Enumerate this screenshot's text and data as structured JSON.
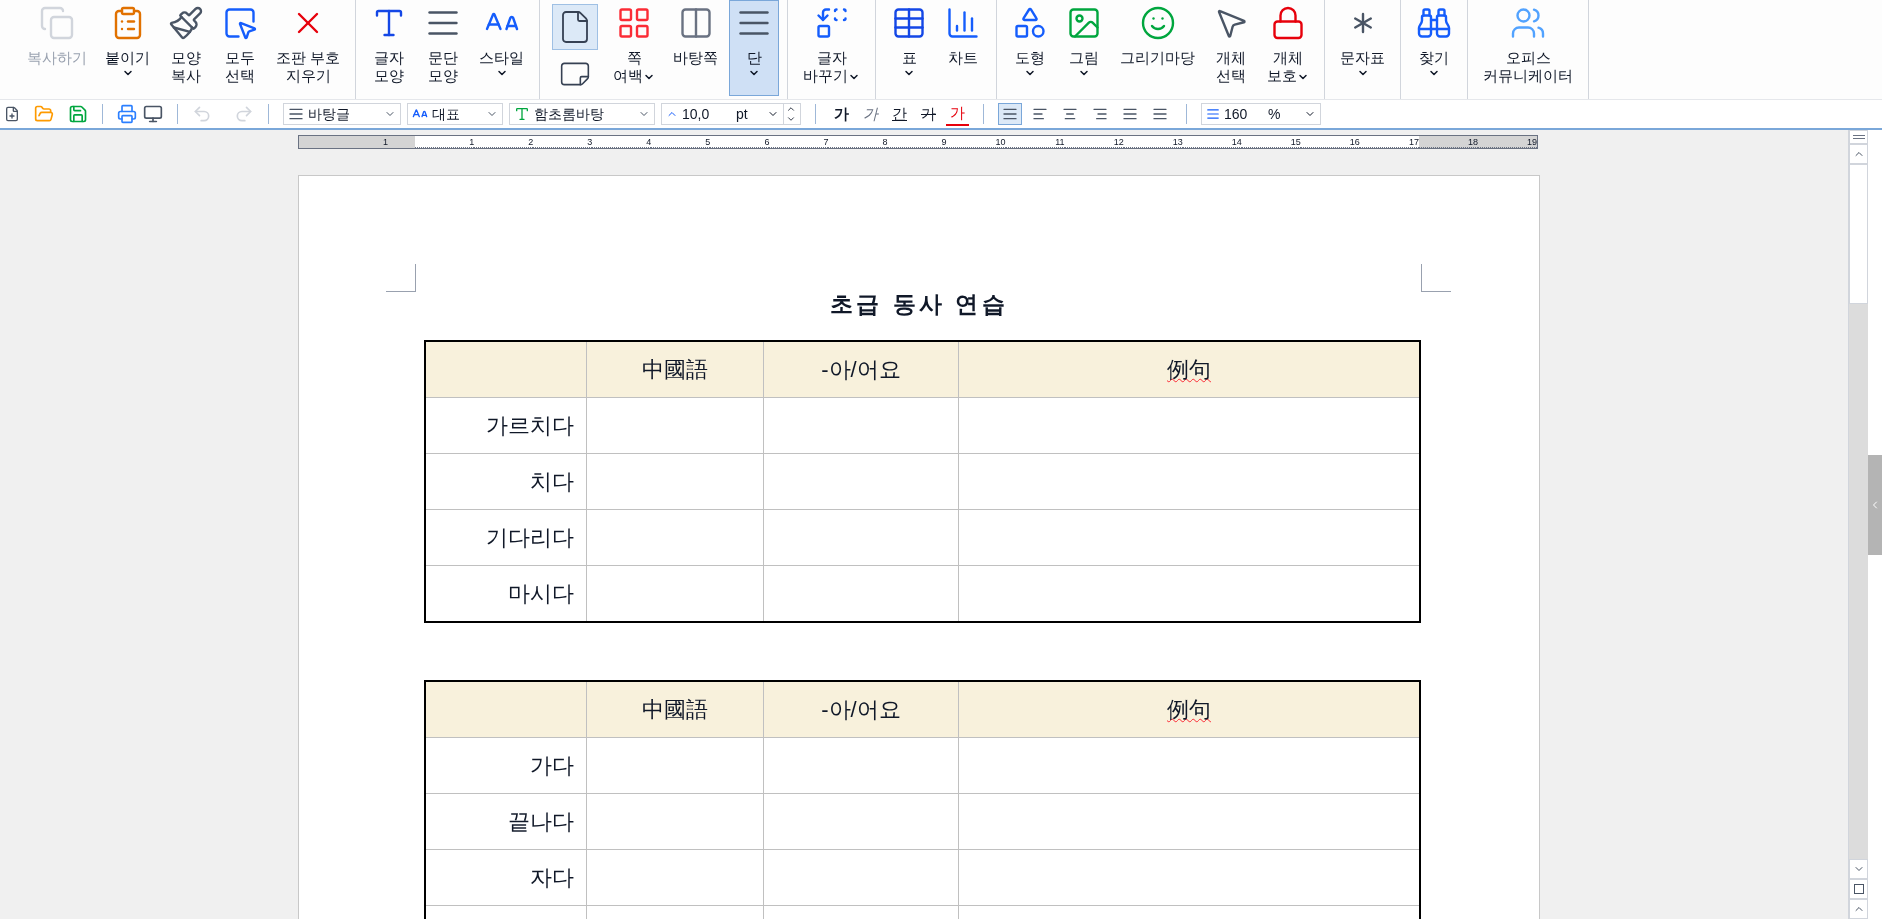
{
  "ribbon": {
    "groups": [
      {
        "items": [
          {
            "kind": "copy",
            "lines": [
              "복사하기"
            ],
            "disabled": true
          },
          {
            "kind": "paste",
            "lines": [
              "붙이기"
            ],
            "menu": true,
            "menu_inline": false
          },
          {
            "kind": "format-copy",
            "lines": [
              "모양",
              "복사"
            ]
          },
          {
            "kind": "select-all",
            "lines": [
              "모두",
              "선택"
            ]
          },
          {
            "kind": "clear-marks",
            "lines": [
              "조판 부호",
              "지우기"
            ]
          }
        ]
      },
      {
        "items": [
          {
            "kind": "char-shape",
            "lines": [
              "글자",
              "모양"
            ]
          },
          {
            "kind": "para-shape",
            "lines": [
              "문단",
              "모양"
            ]
          },
          {
            "kind": "style",
            "lines": [
              "스타일"
            ],
            "menu": true,
            "menu_inline": false
          }
        ]
      },
      {
        "items": [
          {
            "kind": "orientation",
            "selected": true
          },
          {
            "kind": "margins",
            "lines": [
              "쪽",
              "여백"
            ],
            "menu": true,
            "menu_inline": true
          },
          {
            "kind": "master-page",
            "lines": [
              "바탕쪽"
            ]
          },
          {
            "kind": "columns",
            "lines": [
              "단"
            ],
            "menu": true,
            "menu_inline": false,
            "selected": true
          }
        ]
      },
      {
        "items": [
          {
            "kind": "replace",
            "lines": [
              "글자",
              "바꾸기"
            ],
            "menu": true,
            "menu_inline": true
          }
        ]
      },
      {
        "items": [
          {
            "kind": "table",
            "lines": [
              "표"
            ],
            "menu": true,
            "menu_inline": false
          },
          {
            "kind": "chart",
            "lines": [
              "차트"
            ]
          }
        ]
      },
      {
        "items": [
          {
            "kind": "shape",
            "lines": [
              "도형"
            ],
            "menu": true,
            "menu_inline": false
          },
          {
            "kind": "picture",
            "lines": [
              "그림"
            ],
            "menu": true,
            "menu_inline": false
          },
          {
            "kind": "gallery",
            "lines": [
              "그리기마당"
            ]
          },
          {
            "kind": "object-select",
            "lines": [
              "개체",
              "선택"
            ]
          },
          {
            "kind": "object-protect",
            "lines": [
              "개체",
              "보호"
            ],
            "menu": true,
            "menu_inline": true
          }
        ]
      },
      {
        "items": [
          {
            "kind": "symbols",
            "lines": [
              "문자표"
            ],
            "menu": true,
            "menu_inline": false
          }
        ]
      },
      {
        "items": [
          {
            "kind": "find",
            "lines": [
              "찾기"
            ],
            "menu": true,
            "menu_inline": false
          }
        ]
      },
      {
        "items": [
          {
            "kind": "messenger",
            "lines": [
              "오피스",
              "커뮤니케이터"
            ]
          }
        ]
      }
    ]
  },
  "toolbar": {
    "undo": {
      "disabled": true
    },
    "redo": {
      "disabled": true
    },
    "style": "바탕글",
    "language": "대표",
    "font": "함초롬바탕",
    "size": {
      "value": "10,0",
      "unit": "pt"
    },
    "char_buttons": [
      {
        "kind": "bold",
        "text": "가"
      },
      {
        "kind": "italic",
        "text": "가"
      },
      {
        "kind": "underline",
        "text": "간"
      },
      {
        "kind": "strike",
        "text": "가"
      },
      {
        "kind": "color",
        "text": "가"
      }
    ],
    "align_buttons": [
      {
        "kind": "justify",
        "selected": true
      },
      {
        "kind": "left",
        "selected": false
      },
      {
        "kind": "center",
        "selected": false
      },
      {
        "kind": "right",
        "selected": false
      },
      {
        "kind": "distribute",
        "selected": false
      },
      {
        "kind": "divide",
        "selected": false
      }
    ],
    "line_spacing": {
      "value": "160",
      "unit": "%"
    }
  },
  "ruler": {
    "left_labels": [
      "1"
    ],
    "labels": [
      "1",
      "2",
      "3",
      "4",
      "5",
      "6",
      "7",
      "8",
      "9",
      "10",
      "11",
      "12",
      "13",
      "14",
      "15",
      "16",
      "17",
      "18",
      "19"
    ]
  },
  "document": {
    "title": "초급 동사 연습",
    "tables": [
      {
        "header": [
          "中國語",
          "-아/어요",
          "例句"
        ],
        "rows": [
          [
            "가르치다"
          ],
          [
            "치다"
          ],
          [
            "기다리다"
          ],
          [
            "마시다"
          ]
        ],
        "continues": false
      },
      {
        "header": [
          "中國語",
          "-아/어요",
          "例句"
        ],
        "rows": [
          [
            "가다"
          ],
          [
            "끝나다"
          ],
          [
            "자다"
          ]
        ],
        "continues": true
      }
    ]
  }
}
